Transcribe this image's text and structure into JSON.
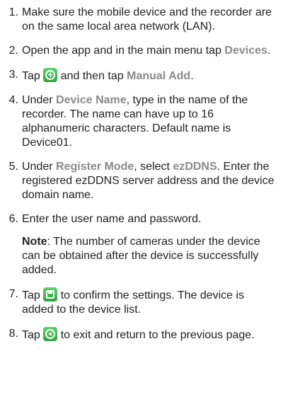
{
  "steps": [
    {
      "num": "1.",
      "text": "Make sure the mobile device and the recorder are on the same local area network (LAN)."
    },
    {
      "num": "2.",
      "pre": "Open the app and in the main menu tap ",
      "hl": "Devices",
      "post": "."
    },
    {
      "num": "3.",
      "pre": "Tap ",
      "icon": "add-circle-icon",
      "mid": " and then tap ",
      "hl": "Manual Add",
      "post": "."
    },
    {
      "num": "4.",
      "pre": "Under ",
      "hl": "Device Name",
      "post": ", type in the name of the recorder. The name can have up to 16 alphanumeric characters. Default name is Device01."
    },
    {
      "num": "5.",
      "pre": "Under ",
      "hl": "Register Mode",
      "mid": ", select ",
      "hl2": "ezDDNS",
      "post": ". Enter the registered ezDDNS server address and the device domain name."
    },
    {
      "num": "6.",
      "text": "Enter the user name and password."
    },
    {
      "num": "7.",
      "pre": "Tap ",
      "icon": "save-icon",
      "post": " to confirm the settings. The device is added to the device list."
    },
    {
      "num": "8.",
      "pre": "Tap ",
      "icon": "back-icon",
      "post": " to exit and return to the previous page."
    }
  ],
  "note": {
    "label": "Note",
    "text": ": The number of cameras under the device can be obtained after the device is successfully added."
  },
  "colors": {
    "highlight": "#8a8a8a",
    "icon_green": "#3cb648"
  }
}
